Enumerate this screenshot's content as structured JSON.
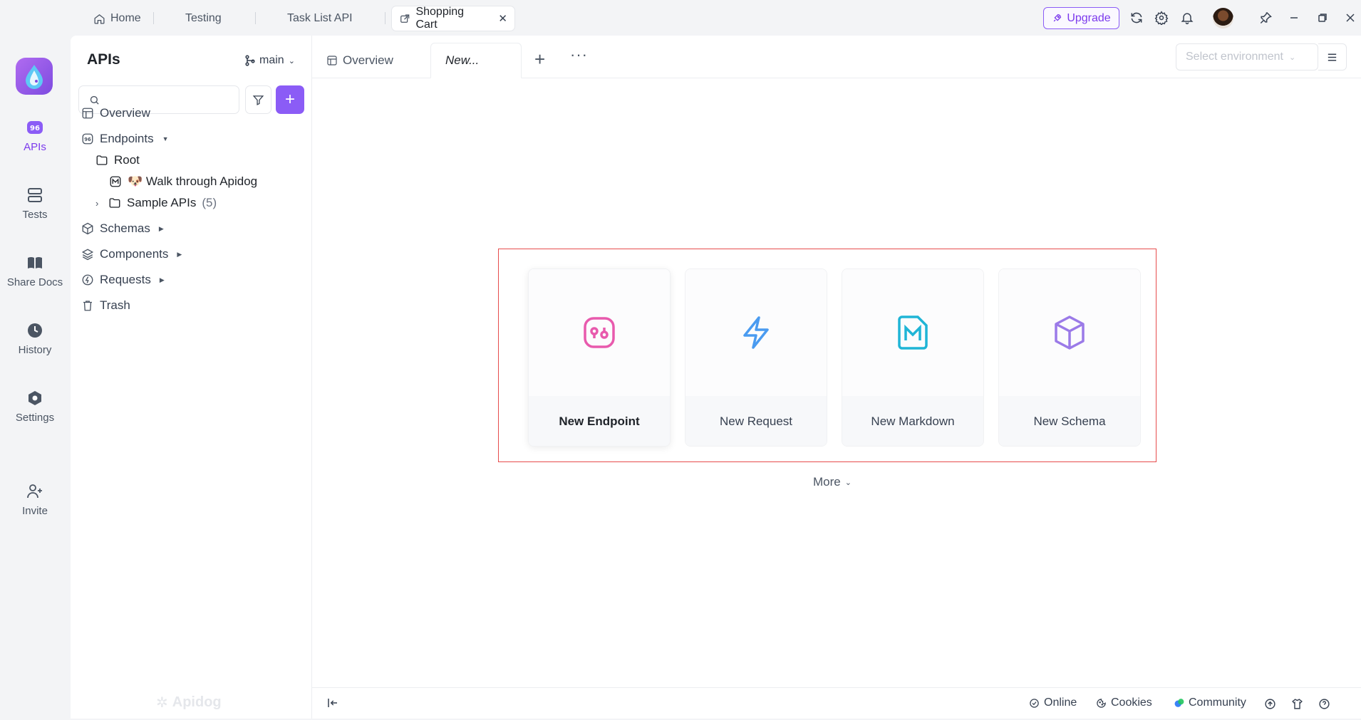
{
  "window_tabs": [
    {
      "label": "Home",
      "icon": "home-icon"
    },
    {
      "label": "Testing"
    },
    {
      "label": "Task List API"
    },
    {
      "label": "Shopping Cart",
      "icon": "external-icon",
      "active": true
    }
  ],
  "topbar": {
    "upgrade_label": "Upgrade"
  },
  "rail": {
    "items": [
      {
        "label": "APIs",
        "icon": "api-icon",
        "active": true
      },
      {
        "label": "Tests",
        "icon": "tests-icon"
      },
      {
        "label": "Share Docs",
        "icon": "book-icon"
      },
      {
        "label": "History",
        "icon": "clock-icon"
      },
      {
        "label": "Settings",
        "icon": "gear-icon"
      },
      {
        "label": "Invite",
        "icon": "user-plus-icon"
      }
    ]
  },
  "sidebar": {
    "title": "APIs",
    "branch": "main",
    "search_placeholder": "",
    "tree": {
      "overview": "Overview",
      "endpoints": "Endpoints",
      "root": "Root",
      "walkthrough": "🐶 Walk through Apidog",
      "sample_apis": "Sample APIs",
      "sample_count": "(5)",
      "schemas": "Schemas",
      "components": "Components",
      "requests": "Requests",
      "trash": "Trash"
    },
    "watermark": "Apidog"
  },
  "main": {
    "tabs": {
      "overview": "Overview",
      "new": "New..."
    },
    "env_placeholder": "Select environment",
    "cards": [
      {
        "label": "New Endpoint",
        "icon": "endpoint-icon",
        "color": "#e85aad"
      },
      {
        "label": "New Request",
        "icon": "lightning-icon",
        "color": "#4a9bf0"
      },
      {
        "label": "New Markdown",
        "icon": "markdown-icon",
        "color": "#1fb5d6"
      },
      {
        "label": "New Schema",
        "icon": "cube-icon",
        "color": "#9b7ae8"
      }
    ],
    "more": "More"
  },
  "status": {
    "online": "Online",
    "cookies": "Cookies",
    "community": "Community"
  }
}
